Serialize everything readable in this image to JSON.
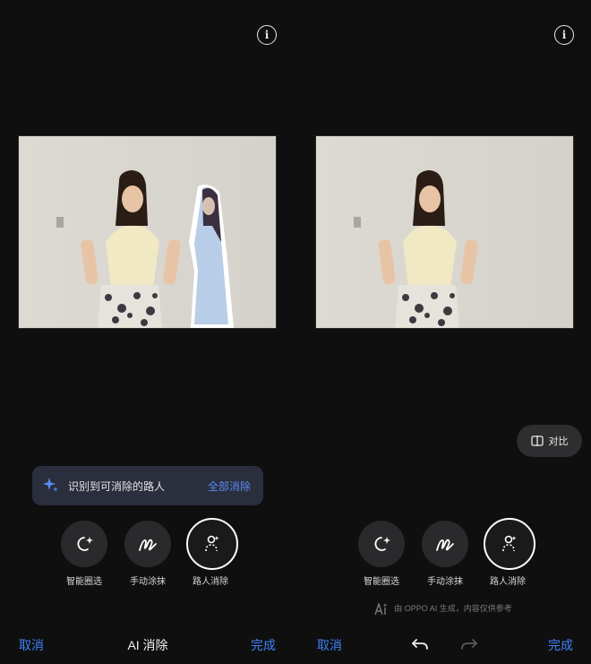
{
  "left": {
    "banner": {
      "message": "识别到可消除的路人",
      "action": "全部消除"
    },
    "tools": [
      {
        "label": "智能圈选",
        "icon": "smart-select-icon"
      },
      {
        "label": "手动涂抹",
        "icon": "brush-icon"
      },
      {
        "label": "路人消除",
        "icon": "passerby-remove-icon"
      }
    ],
    "bottom": {
      "cancel": "取消",
      "title": "AI 消除",
      "done": "完成"
    }
  },
  "right": {
    "compare_label": "对比",
    "tools": [
      {
        "label": "智能圈选",
        "icon": "smart-select-icon"
      },
      {
        "label": "手动涂抹",
        "icon": "brush-icon"
      },
      {
        "label": "路人消除",
        "icon": "passerby-remove-icon"
      }
    ],
    "disclaimer": "由 OPPO AI 生成，内容仅供参考",
    "bottom": {
      "cancel": "取消",
      "done": "完成"
    }
  },
  "colors": {
    "accent": "#3f82f5",
    "background": "#0f0f10"
  }
}
